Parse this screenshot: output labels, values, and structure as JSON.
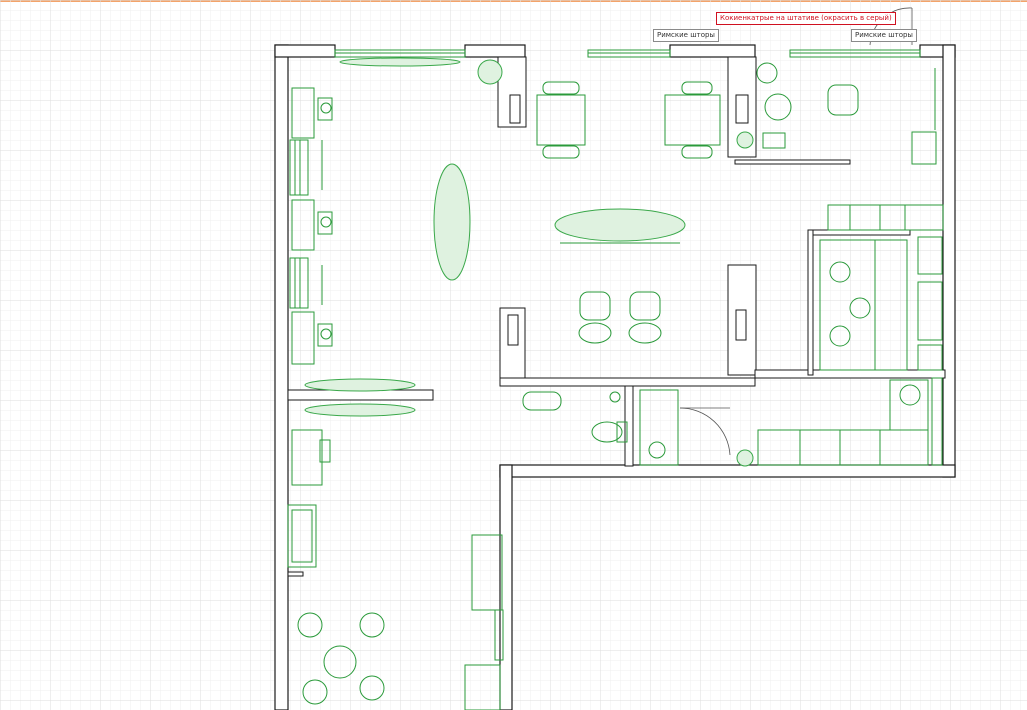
{
  "annotations": {
    "red_note": "Кокиенкатрые на штативе (окрасить в серый)",
    "curtain_left": "Римские шторы",
    "curtain_right": "Римские шторы"
  },
  "colors": {
    "grid_minor": "#eeeeee",
    "grid_major": "#dcdcdc",
    "wall": "#1a1a1a",
    "wall_fill": "#ffffff",
    "furniture": "#2a9a3a",
    "plant": "#3aa84a",
    "accent_bar": "#f3a36a",
    "note_red": "#d01020"
  },
  "icons": [
    "plant-icon",
    "chair-icon",
    "table-icon",
    "toilet-icon",
    "sink-icon",
    "door-swing-icon"
  ]
}
